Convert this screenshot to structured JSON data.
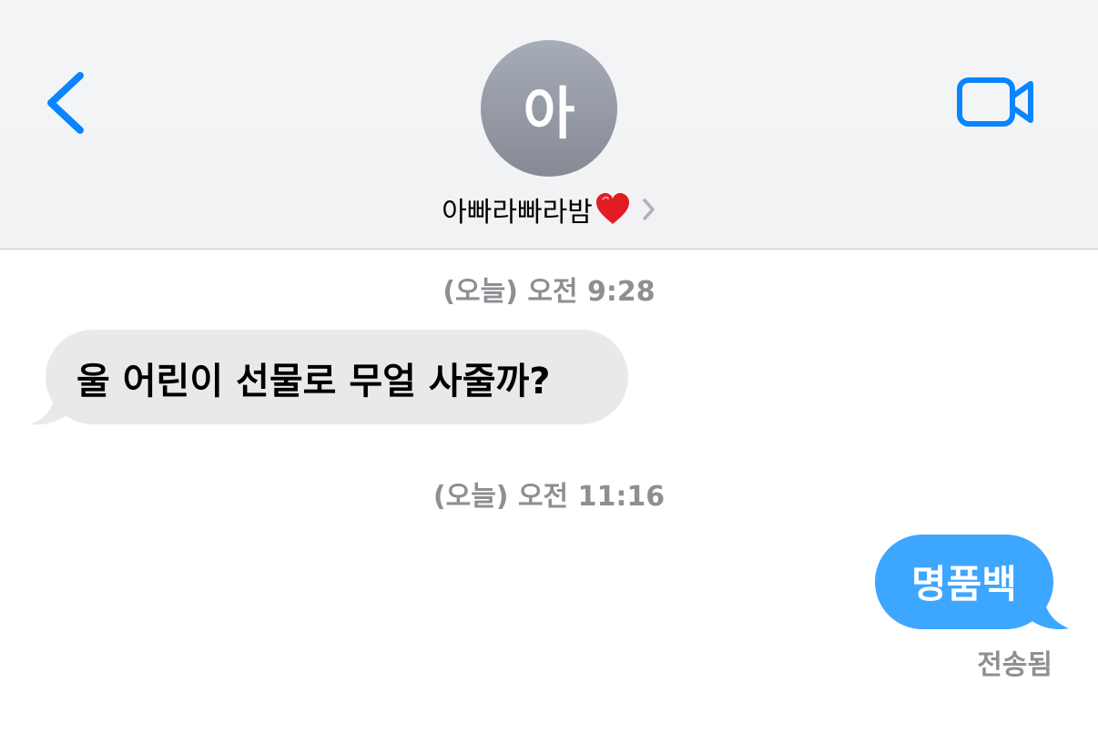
{
  "header": {
    "avatar_initial": "아",
    "contact_name": "아빠라빠라밤",
    "heart_emoji": "heart-icon",
    "accent_color": "#0a84ff"
  },
  "messages": [
    {
      "timestamp": "(오늘) 오전 9:28",
      "direction": "incoming",
      "text": "울 어린이 선물로 무얼 사줄까?"
    },
    {
      "timestamp": "(오늘) 오전 11:16",
      "direction": "outgoing",
      "text": "명품백",
      "status": "전송됨"
    }
  ],
  "colors": {
    "incoming_bubble": "#e9e9eb",
    "outgoing_bubble": "#3da6ff",
    "timestamp_text": "#8e8e93"
  }
}
